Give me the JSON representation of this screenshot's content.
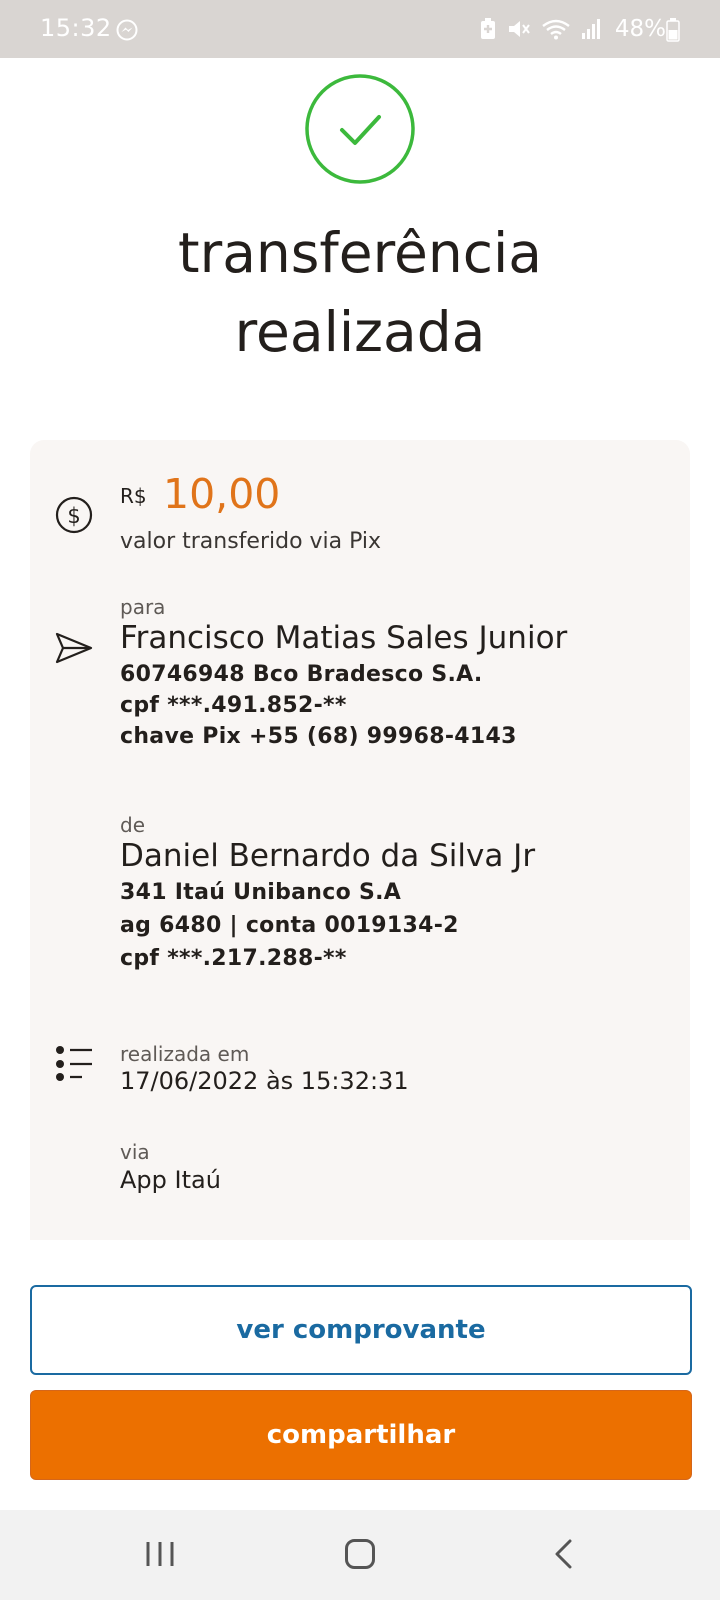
{
  "status_bar": {
    "time": "15:32",
    "battery_percent": "48%",
    "icons": [
      "messenger-icon",
      "battery-saver-icon",
      "mute-icon",
      "wifi-icon",
      "signal-icon",
      "battery-icon"
    ]
  },
  "header": {
    "status_icon": "check-circle-icon",
    "title_line1": "transferência",
    "title_line2": "realizada"
  },
  "transfer": {
    "currency": "R$",
    "amount": "10,00",
    "amount_caption": "valor transferido via Pix",
    "recipient": {
      "label": "para",
      "name": "Francisco Matias Sales Junior",
      "bank": "60746948 Bco Bradesco S.A.",
      "cpf": "cpf ***.491.852-**",
      "pix_key": "chave Pix +55 (68) 99968-4143"
    },
    "sender": {
      "label": "de",
      "name": "Daniel Bernardo da Silva Jr",
      "bank": "341 Itaú Unibanco S.A",
      "account": "ag 6480 | conta 0019134-2",
      "cpf": "cpf ***.217.288-**"
    },
    "date": {
      "label": "realizada em",
      "value": "17/06/2022 às 15:32:31"
    },
    "channel": {
      "label": "via",
      "value": "App Itaú"
    }
  },
  "actions": {
    "view_receipt": "ver comprovante",
    "share": "compartilhar"
  },
  "colors": {
    "accent_orange": "#ec7000",
    "amount_orange": "#e0741a",
    "link_blue": "#1a6aa1",
    "success_green": "#3cb93c",
    "card_bg": "#f9f6f4",
    "status_bar_bg": "#d9d5d2"
  }
}
